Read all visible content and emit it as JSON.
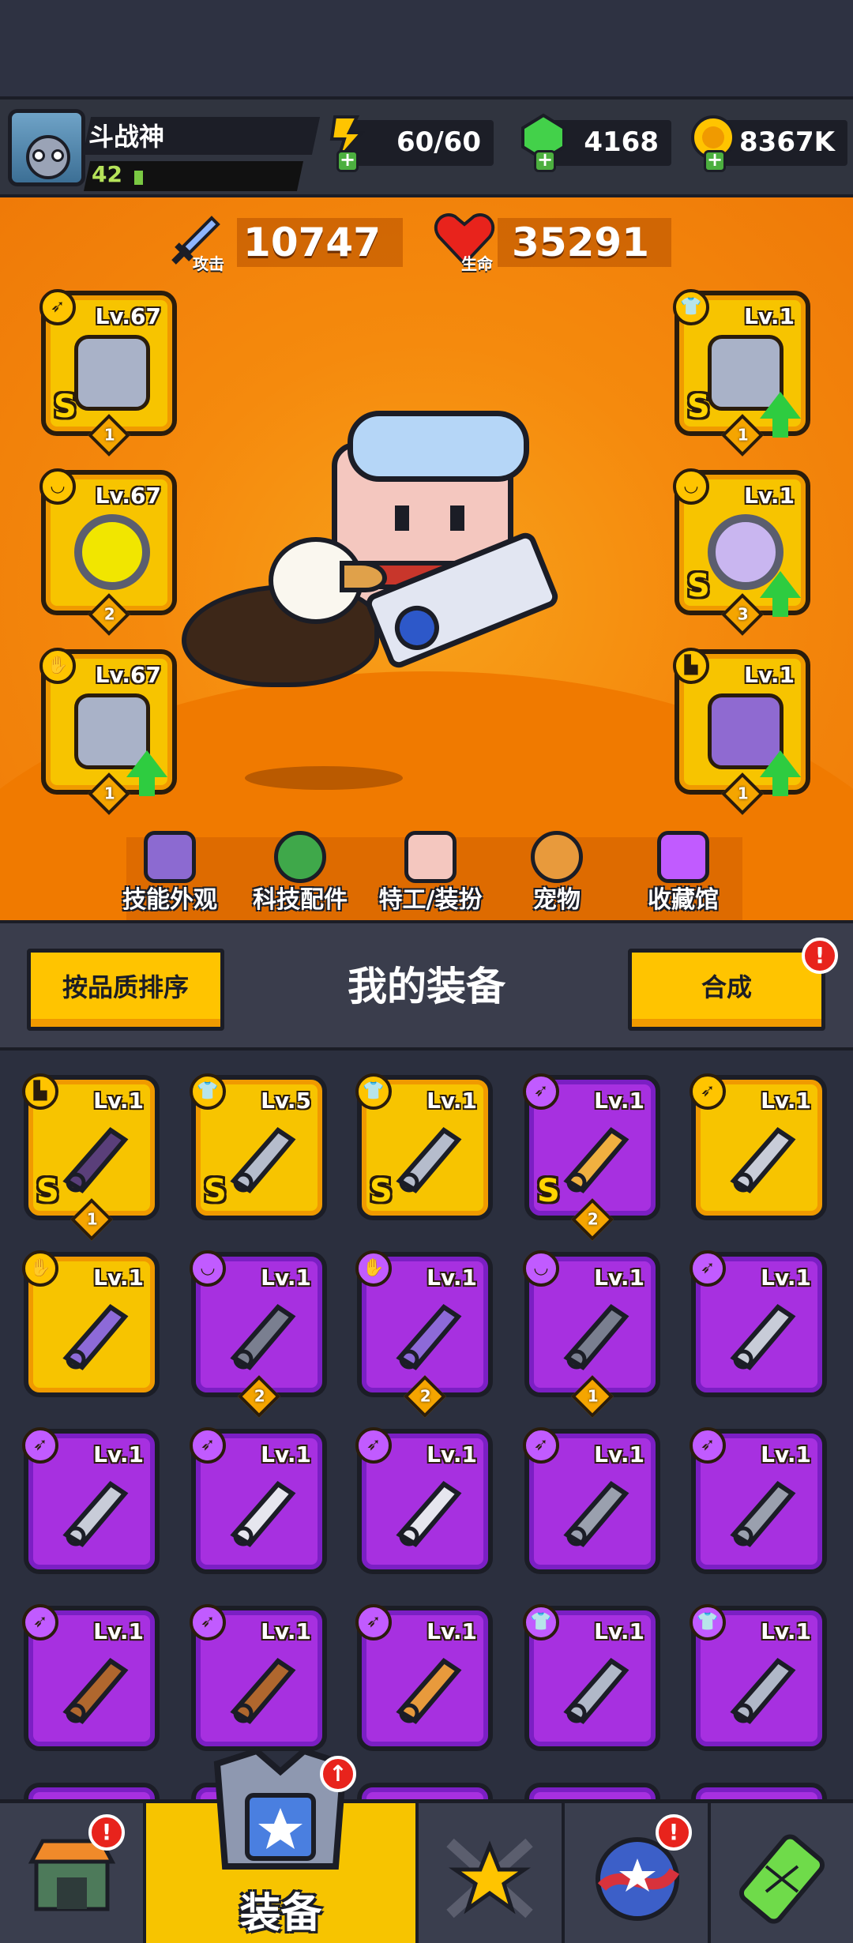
{
  "header": {
    "player_name": "斗战神",
    "player_level": "42",
    "xp_progress": 0.05,
    "energy": "60/60",
    "gems": "4168",
    "coins": "8367K"
  },
  "stats": {
    "attack_value": "10747",
    "attack_label": "攻击",
    "hp_value": "35291",
    "hp_label": "生命"
  },
  "equipped_left": [
    {
      "level": "Lv.67",
      "rank": "S",
      "count": "1",
      "icon": "dagger-icon",
      "upgrade": false
    },
    {
      "level": "Lv.67",
      "rank": "",
      "count": "2",
      "icon": "necklace-icon",
      "upgrade": false
    },
    {
      "level": "Lv.67",
      "rank": "",
      "count": "1",
      "icon": "glove-icon",
      "upgrade": true
    }
  ],
  "equipped_right": [
    {
      "level": "Lv.1",
      "rank": "S",
      "count": "1",
      "icon": "shirt-icon",
      "upgrade": true
    },
    {
      "level": "Lv.1",
      "rank": "S",
      "count": "3",
      "icon": "necklace-icon",
      "upgrade": true
    },
    {
      "level": "Lv.1",
      "rank": "",
      "count": "1",
      "icon": "boot-icon",
      "upgrade": true
    }
  ],
  "nav": [
    {
      "label": "技能外观"
    },
    {
      "label": "科技配件"
    },
    {
      "label": "特工/装扮"
    },
    {
      "label": "宠物"
    },
    {
      "label": "收藏馆"
    }
  ],
  "inventory": {
    "sort_button": "按品质排序",
    "title": "我的装备",
    "merge_button": "合成",
    "merge_alert": "!",
    "rows": [
      [
        {
          "level": "Lv.1",
          "rarity": "yellow",
          "rank": "S",
          "count": "1"
        },
        {
          "level": "Lv.5",
          "rarity": "yellow",
          "rank": "S",
          "count": ""
        },
        {
          "level": "Lv.1",
          "rarity": "yellow",
          "rank": "S",
          "count": ""
        },
        {
          "level": "Lv.1",
          "rarity": "purple",
          "rank": "S",
          "count": "2"
        },
        {
          "level": "Lv.1",
          "rarity": "yellow",
          "rank": "",
          "count": ""
        }
      ],
      [
        {
          "level": "Lv.1",
          "rarity": "yellow",
          "rank": "",
          "count": ""
        },
        {
          "level": "Lv.1",
          "rarity": "purple",
          "rank": "",
          "count": "2"
        },
        {
          "level": "Lv.1",
          "rarity": "purple",
          "rank": "",
          "count": "2"
        },
        {
          "level": "Lv.1",
          "rarity": "purple",
          "rank": "",
          "count": "1"
        },
        {
          "level": "Lv.1",
          "rarity": "purple",
          "rank": "",
          "count": ""
        }
      ],
      [
        {
          "level": "Lv.1",
          "rarity": "purple",
          "rank": "",
          "count": ""
        },
        {
          "level": "Lv.1",
          "rarity": "purple",
          "rank": "",
          "count": ""
        },
        {
          "level": "Lv.1",
          "rarity": "purple",
          "rank": "",
          "count": ""
        },
        {
          "level": "Lv.1",
          "rarity": "purple",
          "rank": "",
          "count": ""
        },
        {
          "level": "Lv.1",
          "rarity": "purple",
          "rank": "",
          "count": ""
        }
      ],
      [
        {
          "level": "Lv.1",
          "rarity": "purple",
          "rank": "",
          "count": ""
        },
        {
          "level": "Lv.1",
          "rarity": "purple",
          "rank": "",
          "count": ""
        },
        {
          "level": "Lv.1",
          "rarity": "purple",
          "rank": "",
          "count": ""
        },
        {
          "level": "Lv.1",
          "rarity": "purple",
          "rank": "",
          "count": ""
        },
        {
          "level": "Lv.1",
          "rarity": "purple",
          "rank": "",
          "count": ""
        }
      ]
    ]
  },
  "bottom_tabs": {
    "shop_alert": "!",
    "equip_label": "装备",
    "equip_alert": "↑",
    "pass_alert": "!"
  },
  "colors": {
    "hero_bg": "#f58a0d",
    "legendary": "#f7c400",
    "epic": "#a730e0",
    "dark": "#1b1d26"
  }
}
